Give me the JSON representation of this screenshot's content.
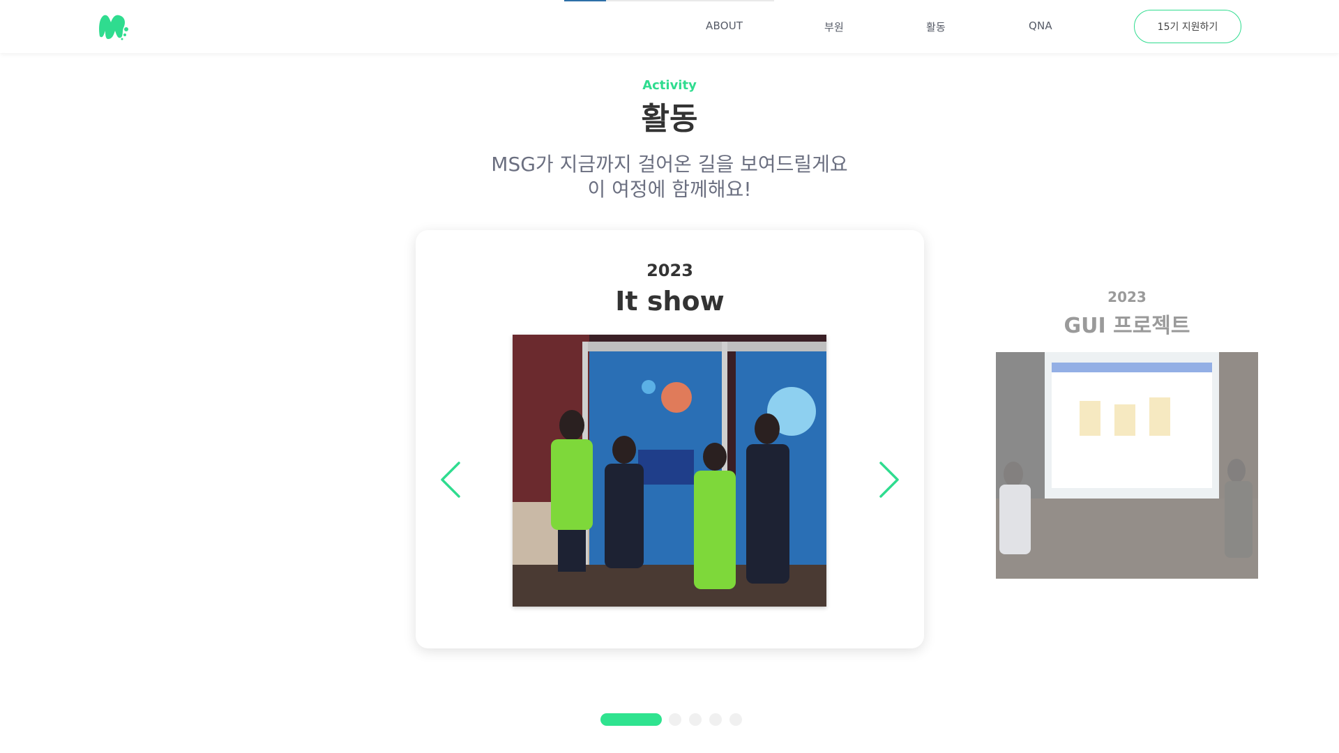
{
  "header": {
    "progress": 0.2,
    "nav": [
      {
        "label": "ABOUT"
      },
      {
        "label": "부원"
      },
      {
        "label": "활동"
      },
      {
        "label": "QNA"
      }
    ],
    "apply_label": "15기 지원하기"
  },
  "section": {
    "eyebrow": "Activity",
    "title": "활동",
    "subtitle_line1": "MSG가 지금까지 걸어온 길을 보여드릴게요",
    "subtitle_line2": "이 여정에 함께해요!"
  },
  "active_slide": {
    "year": "2023",
    "title": "It show",
    "photo_icon": "group-photo-image"
  },
  "next_slide": {
    "year": "2023",
    "title": "GUI 프로젝트",
    "photo_icon": "presentation-photo-image"
  },
  "pagination": {
    "total": 5,
    "active_index": 0
  },
  "colors": {
    "accent": "#2fdc8f",
    "text_dark": "#333333",
    "text_muted": "#6b6f80",
    "progress_bar": "#2d6fa8"
  }
}
